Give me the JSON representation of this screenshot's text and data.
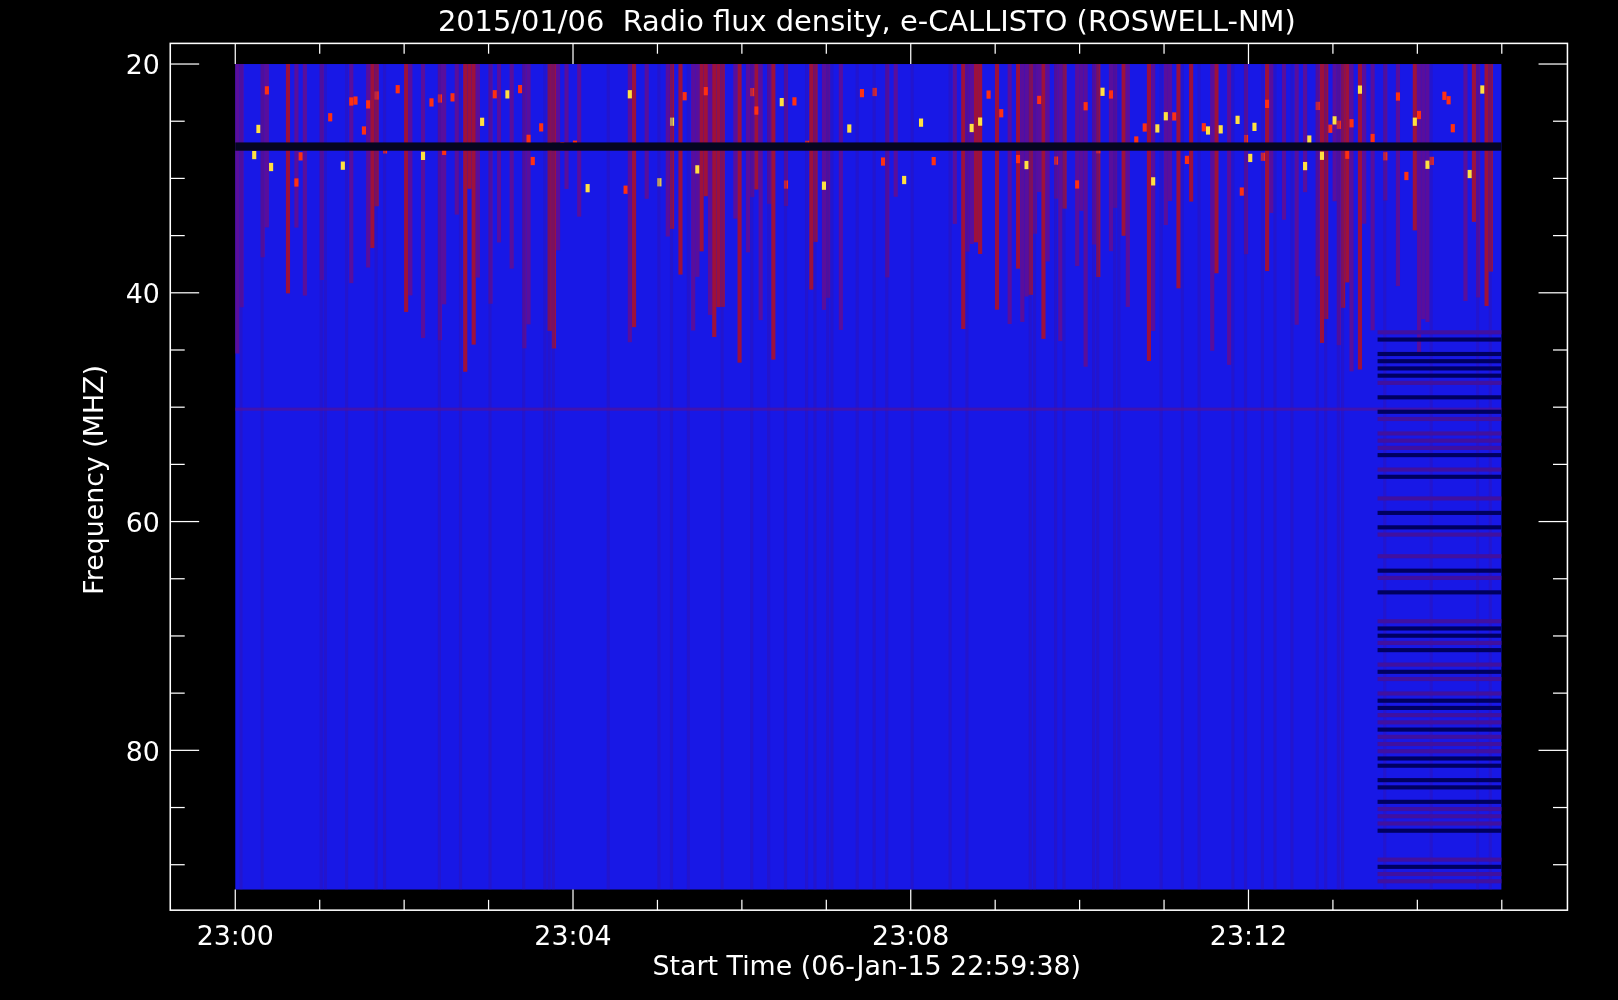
{
  "chart": {
    "title": "2015/01/06  Radio flux density, e-CALLISTO (ROSWELL-NM)",
    "ylabel": "Frequency (MHZ)",
    "xlabel": "Start Time (06-Jan-15 22:59:38)",
    "yticks": [
      "20",
      "40",
      "60",
      "80"
    ],
    "xticks": [
      "23:00",
      "23:04",
      "23:08",
      "23:12"
    ]
  }
}
